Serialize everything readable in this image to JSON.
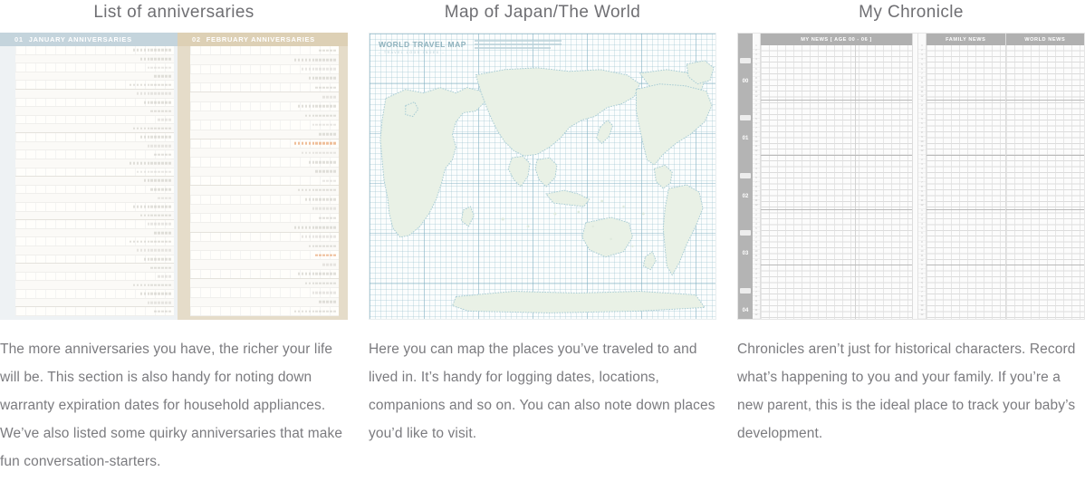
{
  "columns": [
    {
      "heading": "List of anniversaries",
      "caption": "The more anniversaries you have, the richer your life will be. This section is also handy for noting down warranty expiration dates for household appliances. We’ve also listed some quirky anniversaries that make fun conversation-starters.",
      "sample": {
        "type": "anniversary-spread",
        "pages": [
          {
            "number": "01",
            "title": "JANUARY ANNIVERSARIES",
            "tab_color": "#c4d4dc",
            "day_count": 31
          },
          {
            "number": "02",
            "title": "FEBRUARY ANNIVERSARIES",
            "tab_color": "#ddd0b5",
            "day_count": 29
          }
        ]
      }
    },
    {
      "heading": "Map of Japan/The World",
      "caption": "Here you can map the places you’ve traveled to and lived in. It’s handy for logging dates, locations, companions and so on. You can also note down places you’d like to visit.",
      "sample": {
        "type": "world-travel-map",
        "title": "WORLD TRAVEL MAP",
        "subtitle": "– TRAVEL LOGS INDEX –",
        "land_color": "#e9f1e6",
        "coast_color": "#a8ccd4",
        "grid_color": "#96becd",
        "ocean_color": "#fbfdfd"
      }
    },
    {
      "heading": "My Chronicle",
      "caption": "Chronicles aren’t just for historical characters. Record what’s happening to you and your family. If you’re a new parent, this is the ideal place to track your baby’s development.",
      "sample": {
        "type": "chronicle-spread",
        "headers": [
          {
            "label": "MY NEWS  [ AGE 00 - 06 ]",
            "key": "mynews"
          },
          {
            "label": "FAMILY NEWS",
            "key": "family"
          },
          {
            "label": "WORLD NEWS",
            "key": "world"
          }
        ],
        "years": [
          "00",
          "01",
          "02",
          "03",
          "04"
        ],
        "months": [
          "1",
          "2",
          "3",
          "4",
          "5",
          "6",
          "7",
          "8",
          "9",
          "10",
          "11",
          "12"
        ],
        "rail_color": "#b4b4b4",
        "header_color": "#b0b0b0"
      }
    }
  ],
  "theme": {
    "heading_color": "#6f6f73",
    "caption_color": "#7b7b7f",
    "page_background": "#ffffff"
  }
}
